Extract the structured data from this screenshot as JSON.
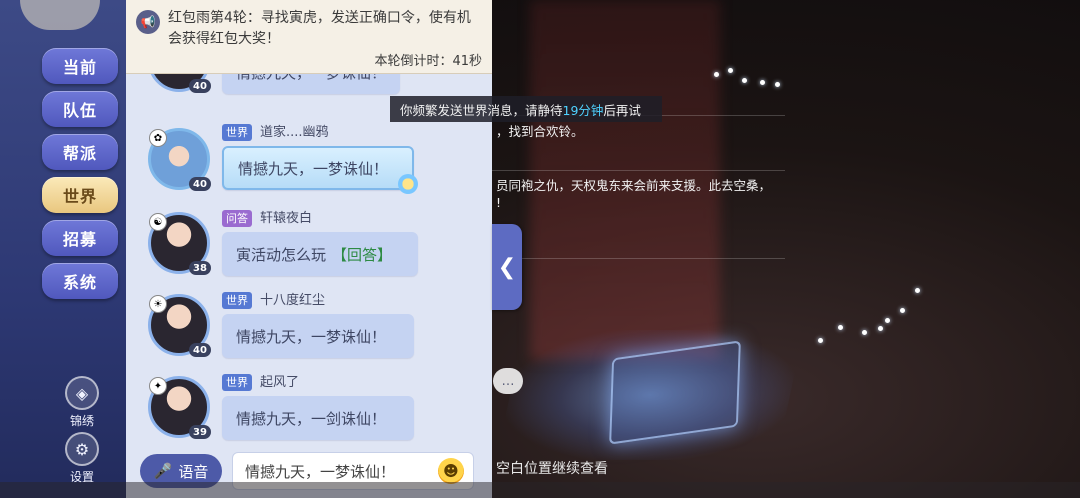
{
  "nav": {
    "items": [
      {
        "label": "当前",
        "active": false
      },
      {
        "label": "队伍",
        "active": false
      },
      {
        "label": "帮派",
        "active": false
      },
      {
        "label": "世界",
        "active": true
      },
      {
        "label": "招募",
        "active": false
      },
      {
        "label": "系统",
        "active": false
      }
    ],
    "tools": [
      {
        "label": "锦绣",
        "icon": "fan-icon"
      },
      {
        "label": "设置",
        "icon": "gear-icon"
      }
    ]
  },
  "announcement": {
    "prefix": "红包雨第4轮",
    "text": "：寻找寅虎，发送正确口令，使有机会获得红包大奖！",
    "countdown": "本轮倒计时：41秒"
  },
  "messages": [
    {
      "channel": "",
      "user": "",
      "text": "情撼九天，一梦诛仙！",
      "level": "40",
      "avatar": "female-avatar"
    },
    {
      "channel": "世界",
      "user": "道家....幽鸦",
      "text": "情撼九天，一梦诛仙！",
      "level": "40",
      "avatar": "crowned-avatar"
    },
    {
      "channel": "问答",
      "user": "轩辕夜白",
      "text": "寅活动怎么玩",
      "answer": "【回答】",
      "level": "38",
      "avatar": "male-avatar"
    },
    {
      "channel": "世界",
      "user": "十八度红尘",
      "text": "情撼九天，一梦诛仙！",
      "level": "40",
      "avatar": "young-avatar"
    },
    {
      "channel": "世界",
      "user": "起风了",
      "text": "情撼九天，一剑诛仙！",
      "level": "39",
      "avatar": "girl-avatar"
    }
  ],
  "input": {
    "voice_label": "语音",
    "value": "情撼九天，一梦诛仙！"
  },
  "toast": {
    "before": "你频繁发送世界消息，请静待",
    "number": "19分钟",
    "after": "后再试"
  },
  "system": {
    "line1": "，找到合欢铃。",
    "line2": "员同袍之仇，天权鬼东来会前来支援。此去空桑，",
    "line3": "!",
    "tip": "空白位置继续查看"
  },
  "colors": {
    "accent": "#5679d3",
    "active_tab": "#e9c77f",
    "highlight": "#4fd2ff"
  }
}
